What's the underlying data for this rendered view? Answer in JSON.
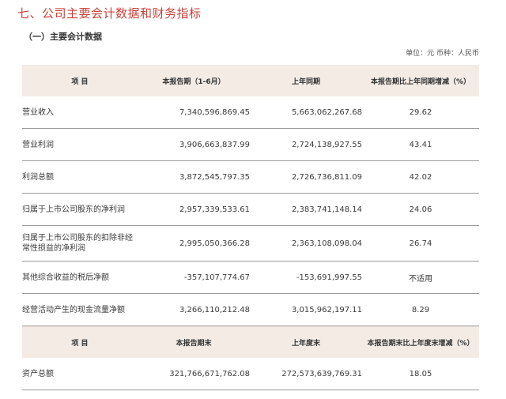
{
  "section_title": "七、公司主要会计数据和财务指标",
  "sub_title": "（一）主要会计数据",
  "unit_note": "单位：元  币种：人民币",
  "table1": {
    "headers": [
      "项  目",
      "本报告期（1-6月）",
      "上年同期",
      "本报告期比上年同期增减（%）"
    ],
    "rows": [
      [
        "营业收入",
        "7,340,596,869.45",
        "5,663,062,267.68",
        "29.62"
      ],
      [
        "营业利润",
        "3,906,663,837.99",
        "2,724,138,927.55",
        "43.41"
      ],
      [
        "利润总额",
        "3,872,545,797.35",
        "2,726,736,811.09",
        "42.02"
      ],
      [
        "归属于上市公司股东的净利润",
        "2,957,339,533.61",
        "2,383,741,148.14",
        "24.06"
      ],
      [
        "归属于上市公司股东的扣除非经常性损益的净利润",
        "2,995,050,366.28",
        "2,363,108,098.04",
        "26.74"
      ],
      [
        "其他综合收益的税后净额",
        "-357,107,774.67",
        "-153,691,997.55",
        "不适用"
      ],
      [
        "经营活动产生的现金流量净额",
        "3,266,110,212.48",
        "3,015,962,197.11",
        "8.29"
      ]
    ]
  },
  "table2": {
    "headers": [
      "项  目",
      "本报告期末",
      "上年度末",
      "本报告期末比上年度末增减（%）"
    ],
    "rows": [
      [
        "资产总额",
        "321,766,671,762.08",
        "272,573,639,769.31",
        "18.05"
      ]
    ]
  }
}
